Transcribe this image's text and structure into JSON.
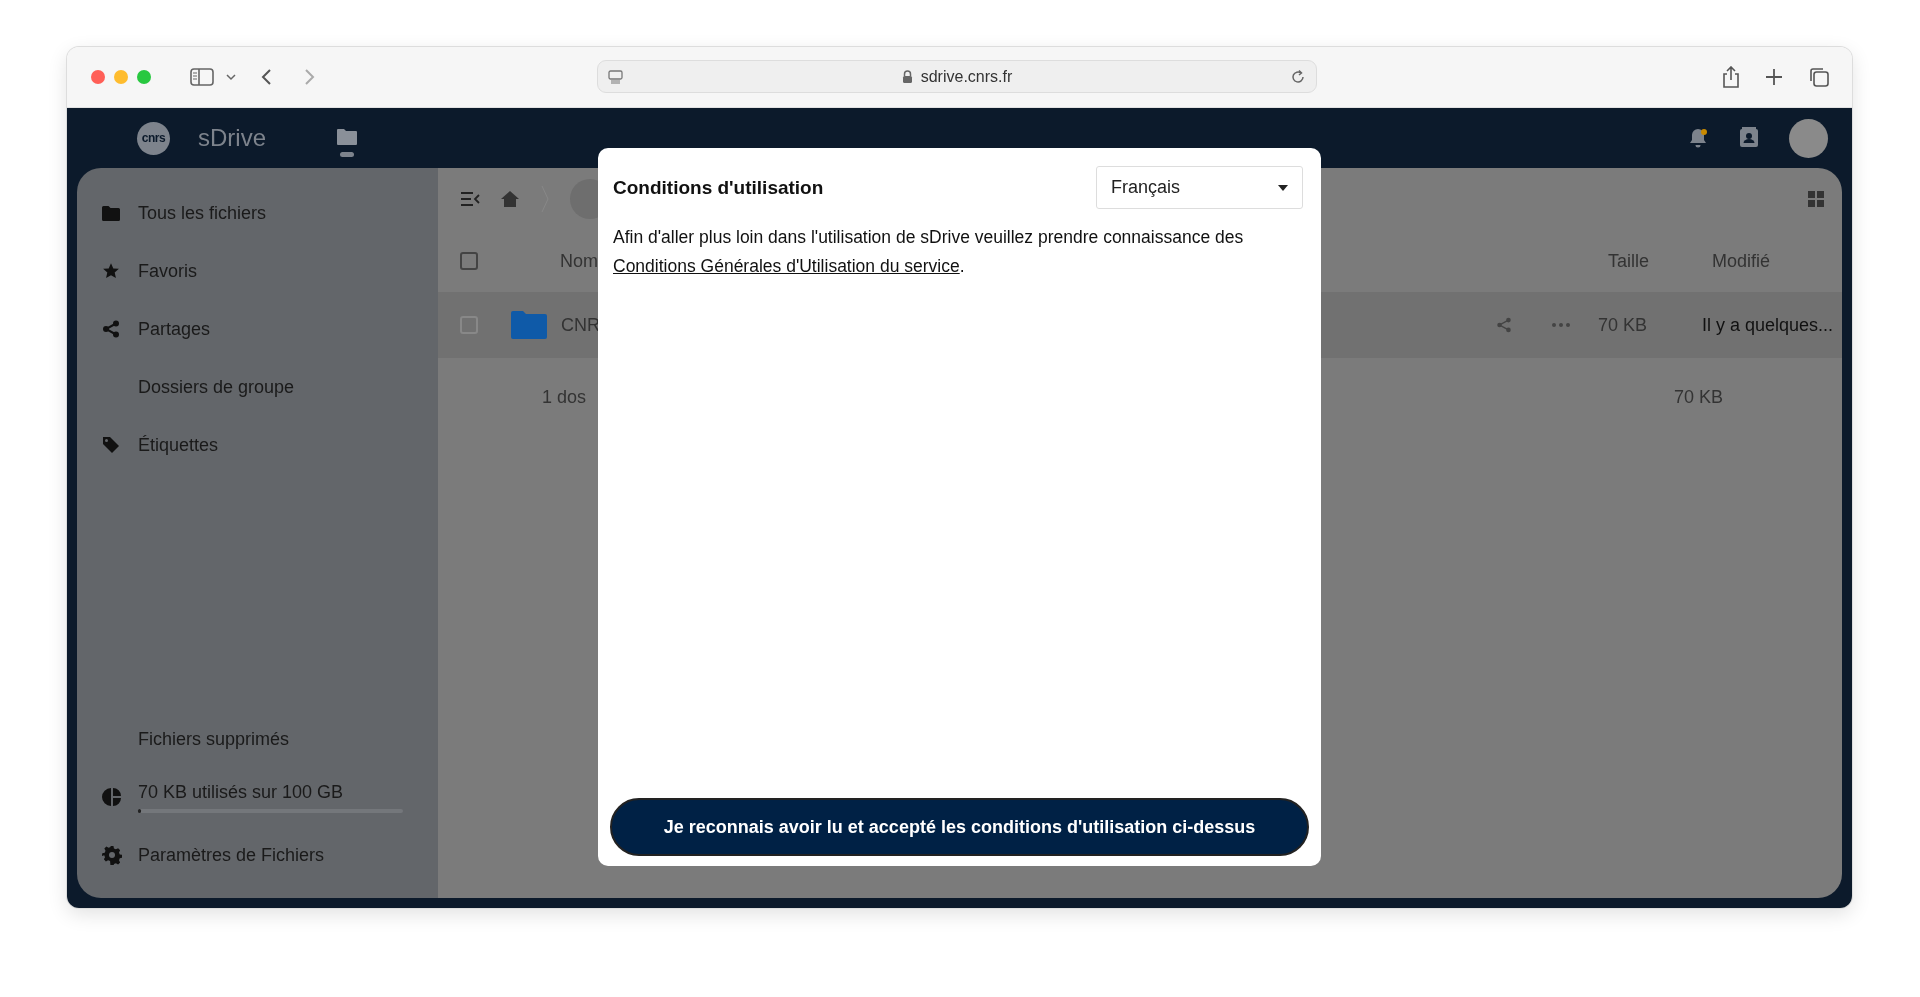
{
  "browser": {
    "url": "sdrive.cnrs.fr"
  },
  "header": {
    "logo_text": "cnrs",
    "brand": "sDrive",
    "notification_unread": true
  },
  "sidebar": {
    "items": [
      {
        "label": "Tous les fichiers",
        "kind": "folder"
      },
      {
        "label": "Favoris",
        "kind": "star"
      },
      {
        "label": "Partages",
        "kind": "share"
      },
      {
        "label": "Dossiers de groupe",
        "kind": "plain"
      },
      {
        "label": "Étiquettes",
        "kind": "tag"
      }
    ],
    "trash": {
      "label": "Fichiers supprimés"
    },
    "storage": {
      "label": "70 KB utilisés sur 100 GB",
      "level": 0.01
    },
    "settings": {
      "label": "Paramètres de Fichiers"
    }
  },
  "files": {
    "all_selected": false,
    "columns": {
      "name": "Nom",
      "size": "Taille",
      "modified": "Modifié"
    },
    "rows": [
      {
        "name": "CNR",
        "size": "70 KB",
        "modified": "Il y a quelques...",
        "selected": false
      }
    ],
    "summary": {
      "name": "1 dos",
      "size": "70 KB"
    }
  },
  "dialog": {
    "title": "Conditions d'utilisation",
    "language": "Français",
    "text": "Afin d'aller plus loin dans l'utilisation de sDrive veuillez prendre connaissance des",
    "link": "Conditions Générales d'Utilisation du service",
    "after_link": ".",
    "button": "Je reconnais avoir lu et accepté les conditions d'utilisation ci-dessus"
  }
}
